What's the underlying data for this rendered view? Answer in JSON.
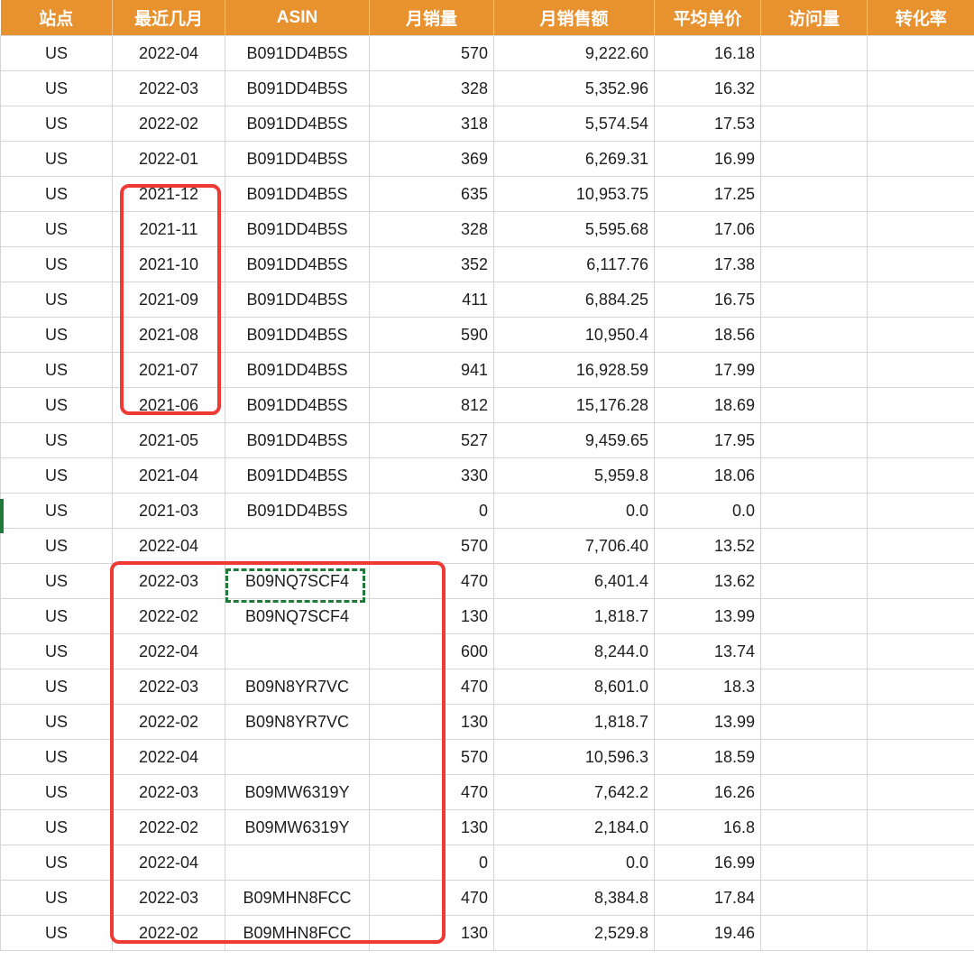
{
  "headers": [
    "站点",
    "最近几月",
    "ASIN",
    "月销量",
    "月销售额",
    "平均单价",
    "访问量",
    "转化率"
  ],
  "rows": [
    [
      "US",
      "2022-04",
      "B091DD4B5S",
      "570",
      "9,222.60",
      "16.18",
      "",
      ""
    ],
    [
      "US",
      "2022-03",
      "B091DD4B5S",
      "328",
      "5,352.96",
      "16.32",
      "",
      ""
    ],
    [
      "US",
      "2022-02",
      "B091DD4B5S",
      "318",
      "5,574.54",
      "17.53",
      "",
      ""
    ],
    [
      "US",
      "2022-01",
      "B091DD4B5S",
      "369",
      "6,269.31",
      "16.99",
      "",
      ""
    ],
    [
      "US",
      "2021-12",
      "B091DD4B5S",
      "635",
      "10,953.75",
      "17.25",
      "",
      ""
    ],
    [
      "US",
      "2021-11",
      "B091DD4B5S",
      "328",
      "5,595.68",
      "17.06",
      "",
      ""
    ],
    [
      "US",
      "2021-10",
      "B091DD4B5S",
      "352",
      "6,117.76",
      "17.38",
      "",
      ""
    ],
    [
      "US",
      "2021-09",
      "B091DD4B5S",
      "411",
      "6,884.25",
      "16.75",
      "",
      ""
    ],
    [
      "US",
      "2021-08",
      "B091DD4B5S",
      "590",
      "10,950.4",
      "18.56",
      "",
      ""
    ],
    [
      "US",
      "2021-07",
      "B091DD4B5S",
      "941",
      "16,928.59",
      "17.99",
      "",
      ""
    ],
    [
      "US",
      "2021-06",
      "B091DD4B5S",
      "812",
      "15,176.28",
      "18.69",
      "",
      ""
    ],
    [
      "US",
      "2021-05",
      "B091DD4B5S",
      "527",
      "9,459.65",
      "17.95",
      "",
      ""
    ],
    [
      "US",
      "2021-04",
      "B091DD4B5S",
      "330",
      "5,959.8",
      "18.06",
      "",
      ""
    ],
    [
      "US",
      "2021-03",
      "B091DD4B5S",
      "0",
      "0.0",
      "0.0",
      "",
      ""
    ],
    [
      "US",
      "2022-04",
      "",
      "570",
      "7,706.40",
      "13.52",
      "",
      ""
    ],
    [
      "US",
      "2022-03",
      "B09NQ7SCF4",
      "470",
      "6,401.4",
      "13.62",
      "",
      ""
    ],
    [
      "US",
      "2022-02",
      "B09NQ7SCF4",
      "130",
      "1,818.7",
      "13.99",
      "",
      ""
    ],
    [
      "US",
      "2022-04",
      "",
      "600",
      "8,244.0",
      "13.74",
      "",
      ""
    ],
    [
      "US",
      "2022-03",
      "B09N8YR7VC",
      "470",
      "8,601.0",
      "18.3",
      "",
      ""
    ],
    [
      "US",
      "2022-02",
      "B09N8YR7VC",
      "130",
      "1,818.7",
      "13.99",
      "",
      ""
    ],
    [
      "US",
      "2022-04",
      "",
      "570",
      "10,596.3",
      "18.59",
      "",
      ""
    ],
    [
      "US",
      "2022-03",
      "B09MW6319Y",
      "470",
      "7,642.2",
      "16.26",
      "",
      ""
    ],
    [
      "US",
      "2022-02",
      "B09MW6319Y",
      "130",
      "2,184.0",
      "16.8",
      "",
      ""
    ],
    [
      "US",
      "2022-04",
      "",
      "0",
      "0.0",
      "16.99",
      "",
      ""
    ],
    [
      "US",
      "2022-03",
      "B09MHN8FCC",
      "470",
      "8,384.8",
      "17.84",
      "",
      ""
    ],
    [
      "US",
      "2022-02",
      "B09MHN8FCC",
      "130",
      "2,529.8",
      "19.46",
      "",
      ""
    ]
  ],
  "colors": {
    "header_background": "#E8912F",
    "header_text": "#FFFFFF",
    "highlight_box": "#EE3A33",
    "copy_marquee": "#1F7A3A"
  }
}
